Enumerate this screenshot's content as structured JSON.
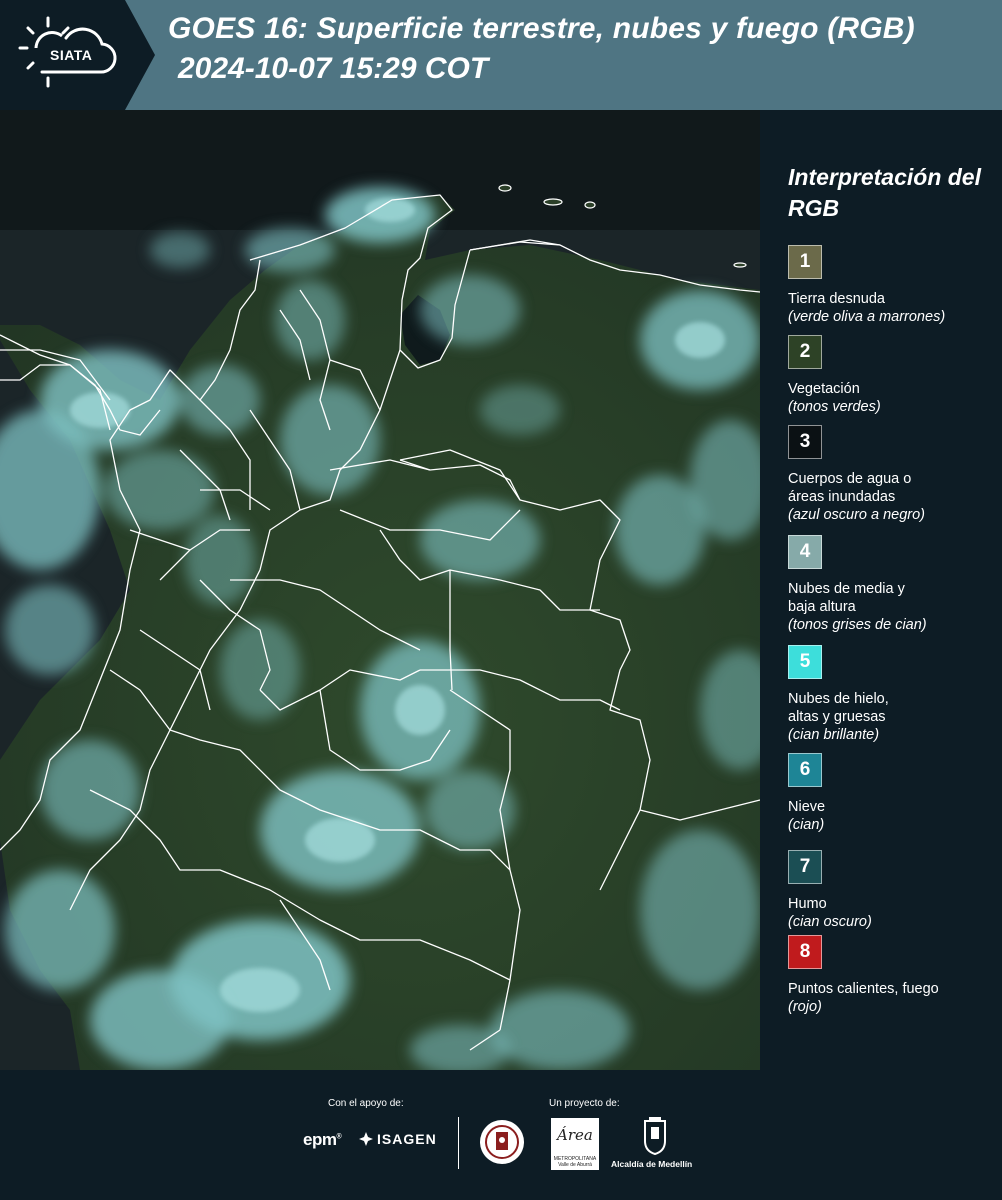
{
  "header": {
    "brand": "SIATA",
    "title": "GOES 16: Superficie terrestre, nubes y fuego (RGB)",
    "datetime": "2024-10-07 15:29 COT"
  },
  "legend": {
    "title": "Interpretación del RGB",
    "items": [
      {
        "num": "1",
        "label": "Tierra desnuda",
        "desc": "(verde oliva a marrones)",
        "color": "#6b6a4a"
      },
      {
        "num": "2",
        "label": "Vegetación",
        "desc": "(tonos verdes)",
        "color": "#2d4226"
      },
      {
        "num": "3",
        "label": "Cuerpos de agua o\náreas inundadas",
        "desc": "(azul oscuro a negro)",
        "color": "#0b1114"
      },
      {
        "num": "4",
        "label": "Nubes de media y\nbaja altura",
        "desc": "(tonos grises de cian)",
        "color": "#86aaa9"
      },
      {
        "num": "5",
        "label": "Nubes de hielo,\naltas y gruesas",
        "desc": "(cian brillante)",
        "color": "#3ddedb"
      },
      {
        "num": "6",
        "label": "Nieve",
        "desc": "(cian)",
        "color": "#1e8596"
      },
      {
        "num": "7",
        "label": "Humo",
        "desc": "(cian oscuro)",
        "color": "#1b4e54"
      },
      {
        "num": "8",
        "label": "Puntos calientes, fuego",
        "desc": "(rojo)",
        "color": "#c01b1d"
      }
    ]
  },
  "footer": {
    "support_caption": "Con el apoyo de:",
    "project_caption": "Un proyecto de:",
    "sponsors": {
      "epm": "epm",
      "isagen": "ISAGEN"
    },
    "partners": {
      "metro_name": "Área",
      "metro_subtitle": "METROPOLITANA\nValle de Aburrá",
      "alcaldia": "Alcaldía de Medellín"
    }
  },
  "colors": {
    "header_bg": "#4f7583",
    "logo_panel_bg": "#0d1c25",
    "page_bg": "#0d1c25",
    "vegetation": "#2b3f28",
    "ocean": "#1a2529",
    "cloud": "#7ec5c6",
    "border_line": "#ffffff"
  },
  "icons": [
    "sun-cloud-logo-icon",
    "isagen-leaf-icon",
    "university-seal-icon",
    "metropolitana-logo-icon",
    "medellin-shield-icon"
  ]
}
